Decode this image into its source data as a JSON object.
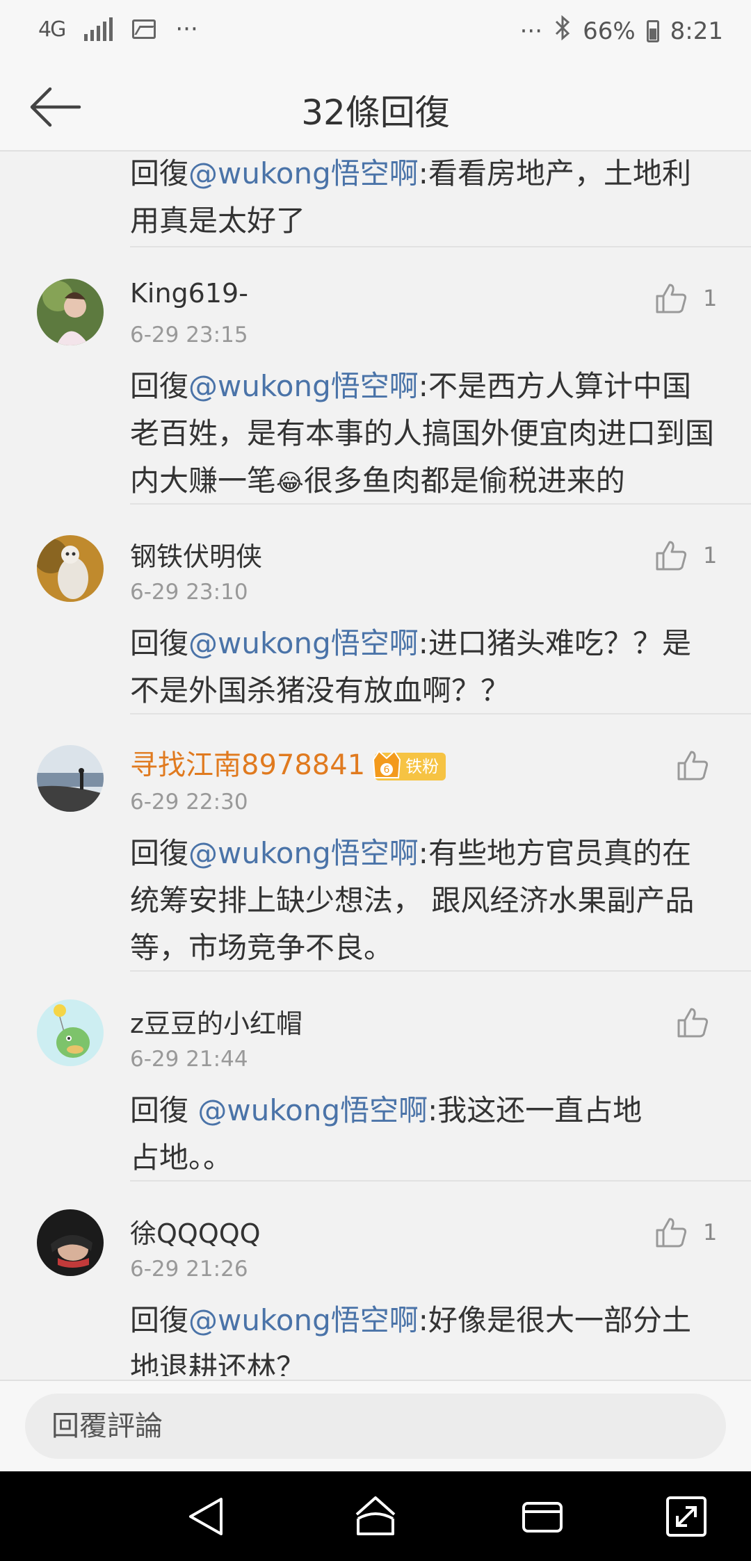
{
  "status_bar": {
    "network": "4G",
    "more": "···",
    "right_more": "···",
    "battery": "66%",
    "time": "8:21"
  },
  "header": {
    "title": "32條回復"
  },
  "comments": [
    {
      "reply_prefix": "回復",
      "mention": "@wukong悟空啊",
      "text": ":看看房地产，土地利用真是太好了"
    },
    {
      "name": "King619-",
      "time": "6-29 23:15",
      "likes": "1",
      "reply_prefix": "回復",
      "mention": "@wukong悟空啊",
      "text": ":不是西方人算计中国老百姓，是有本事的人搞国外便宜肉进口到国内大赚一笔",
      "emoji": "😂",
      "text_after": "很多鱼肉都是偷税进来的"
    },
    {
      "name": "钢铁伏明侠",
      "time": "6-29 23:10",
      "likes": "1",
      "reply_prefix": "回復",
      "mention": "@wukong悟空啊",
      "text": ":进口猪头难吃？？是不是外国杀猪没有放血啊？？"
    },
    {
      "name": "寻找江南8978841",
      "badge": "铁粉",
      "badge_level": "6",
      "time": "6-29 22:30",
      "likes": "",
      "reply_prefix": "回復",
      "mention": "@wukong悟空啊",
      "text": ":有些地方官员真的在统筹安排上缺少想法， 跟风经济水果副产品等，市场竞争不良。"
    },
    {
      "name": "z豆豆的小红帽",
      "time": "6-29 21:44",
      "likes": "",
      "reply_prefix": "回復 ",
      "mention": "@wukong悟空啊",
      "text": ":我这还一直占地占地。。"
    },
    {
      "name": "徐QQQQQ",
      "time": "6-29 21:26",
      "likes": "1",
      "reply_prefix": "回復",
      "mention": "@wukong悟空啊",
      "text": ":好像是很大一部分土地退耕还林？"
    }
  ],
  "input": {
    "placeholder": "回覆評論"
  },
  "colors": {
    "mention": "#4a73a8",
    "vip_name": "#e07a1f",
    "badge": "#f6c343"
  }
}
